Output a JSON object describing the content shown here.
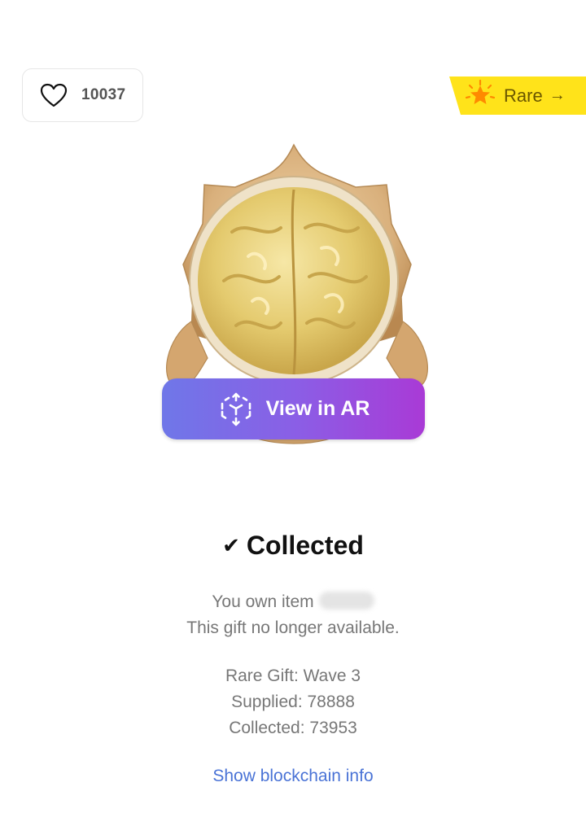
{
  "likes": {
    "count": "10037",
    "icon": "heart-outline-icon"
  },
  "rarity": {
    "label": "Rare",
    "arrow": "→",
    "icon": "star-burst-icon",
    "color": "#ffe31a"
  },
  "ar_button": {
    "label": "View in AR",
    "icon": "ar-cube-icon"
  },
  "status": {
    "check": "✔",
    "label": "Collected"
  },
  "ownership": {
    "own_text": "You own item",
    "availability": "This gift no longer available."
  },
  "stats": {
    "wave": "Rare Gift: Wave 3",
    "supplied": "Supplied: 78888",
    "collected": "Collected: 73953"
  },
  "blockchain_link": "Show blockchain info"
}
